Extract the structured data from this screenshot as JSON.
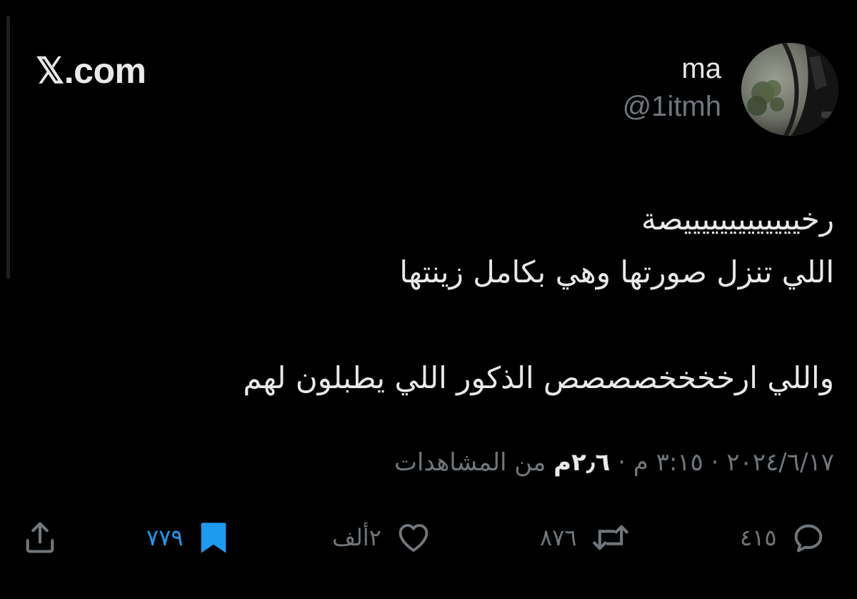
{
  "site": {
    "logo_text": "𝕏.com"
  },
  "author": {
    "name": "ma",
    "handle": "@1itmh",
    "avatar_icon": "avatar-photo"
  },
  "tweet": {
    "lines": [
      "رخيييييييييييييصة",
      "اللي تنزل صورتها وهي بكامل زينتها",
      "",
      "واللي ارخخخخصصصص الذكور اللي يطبلون لهم"
    ]
  },
  "meta": {
    "date": "٢٠٢٤/٦/١٧",
    "separator": " · ",
    "time": "٣:١٥ م",
    "views_count": "٢٫٦م",
    "views_label": " من المشاهدات"
  },
  "actions": {
    "reply": {
      "icon": "reply-icon",
      "count": "٤١٥"
    },
    "repost": {
      "icon": "repost-icon",
      "count": "٨٧٦"
    },
    "like": {
      "icon": "heart-icon",
      "count": "٢ألف"
    },
    "bookmark": {
      "icon": "bookmark-icon",
      "count": "٧٧٩",
      "active": true
    },
    "share": {
      "icon": "share-icon"
    }
  },
  "colors": {
    "background": "#000000",
    "primary_text": "#e7e9ea",
    "secondary_text": "#71767b",
    "accent": "#1d9bf0"
  }
}
